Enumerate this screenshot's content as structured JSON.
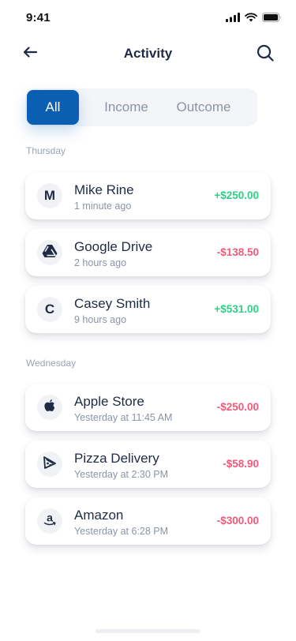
{
  "status_bar": {
    "time": "9:41"
  },
  "header": {
    "title": "Activity"
  },
  "tabs": [
    {
      "label": "All",
      "active": true
    },
    {
      "label": "Income",
      "active": false
    },
    {
      "label": "Outcome",
      "active": false
    }
  ],
  "sections": [
    {
      "label": "Thursday",
      "transactions": [
        {
          "initial": "M",
          "icon": "",
          "name": "Mike Rine",
          "time": "1 minute ago",
          "amount": "+$250.00",
          "direction": "in"
        },
        {
          "initial": "",
          "icon": "google-drive-icon",
          "name": "Google Drive",
          "time": "2 hours ago",
          "amount": "-$138.50",
          "direction": "out"
        },
        {
          "initial": "C",
          "icon": "",
          "name": "Casey Smith",
          "time": "9 hours ago",
          "amount": "+$531.00",
          "direction": "in"
        }
      ]
    },
    {
      "label": "Wednesday",
      "transactions": [
        {
          "initial": "",
          "icon": "apple-icon",
          "name": "Apple Store",
          "time": "Yesterday at 11:45 AM",
          "amount": "-$250.00",
          "direction": "out"
        },
        {
          "initial": "",
          "icon": "pizza-icon",
          "name": "Pizza Delivery",
          "time": "Yesterday at 2:30 PM",
          "amount": "-$58.90",
          "direction": "out"
        },
        {
          "initial": "",
          "icon": "amazon-icon",
          "name": "Amazon",
          "time": "Yesterday at 6:28 PM",
          "amount": "-$300.00",
          "direction": "out"
        }
      ]
    }
  ],
  "colors": {
    "accent": "#0b5fb3",
    "income": "#2ecf86",
    "outcome": "#ef5a7a",
    "text": "#1f2a44",
    "muted": "#8b94a6"
  }
}
